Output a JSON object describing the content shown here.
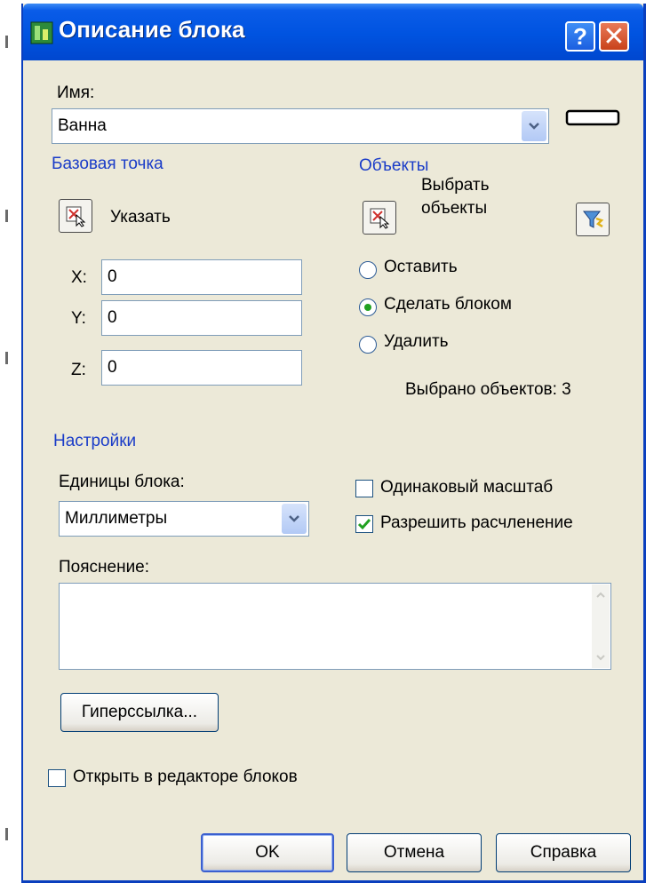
{
  "window": {
    "title": "Описание блока"
  },
  "name": {
    "label": "Имя:",
    "value": "Ванна"
  },
  "base_point": {
    "heading": "Базовая точка",
    "specify_label": "Указать",
    "x_label": "X:",
    "x_value": "0",
    "y_label": "Y:",
    "y_value": "0",
    "z_label": "Z:",
    "z_value": "0"
  },
  "objects": {
    "heading": "Объекты",
    "select_label_line1": "Выбрать",
    "select_label_line2": "объекты",
    "retain_label": "Оставить",
    "convert_label": "Сделать блоком",
    "delete_label": "Удалить",
    "selected_mode": "convert",
    "count_text": "Выбрано объектов: 3"
  },
  "settings": {
    "heading": "Настройки",
    "units_label": "Единицы блока:",
    "units_value": "Миллиметры",
    "scale_uniformly_label": "Одинаковый масштаб",
    "scale_uniformly_checked": false,
    "allow_explode_label": "Разрешить расчленение",
    "allow_explode_checked": true,
    "description_label": "Пояснение:",
    "description_value": "",
    "hyperlink_label": "Гиперссылка..."
  },
  "open_in_editor": {
    "label": "Открыть в редакторе блоков",
    "checked": false
  },
  "buttons": {
    "ok": "OK",
    "cancel": "Отмена",
    "help": "Справка"
  },
  "colors": {
    "titlebar": "#0053e0",
    "dialog_bg": "#ece9d8",
    "section_heading": "#1a3cc8",
    "radio_dot": "#21a121",
    "check_mark": "#21a121"
  }
}
